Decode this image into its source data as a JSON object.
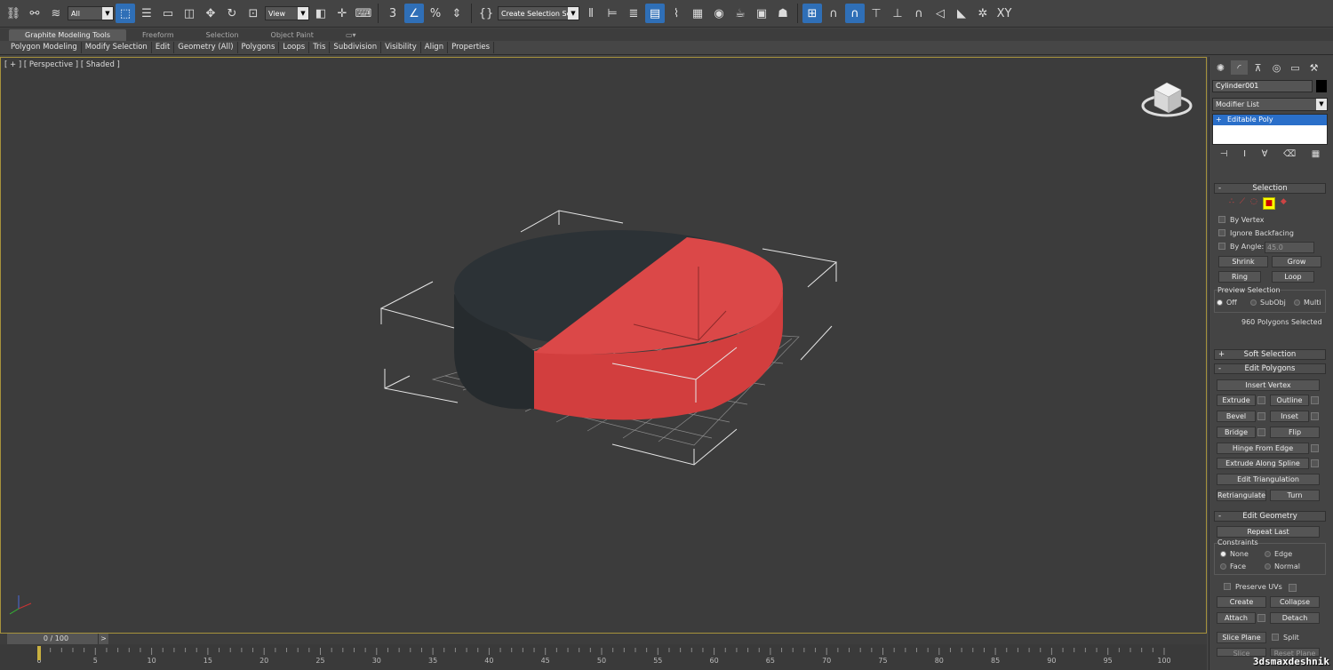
{
  "toolbar": {
    "selection_filter": "All",
    "ref_coord": "View",
    "named_selection": "Create Selection Se",
    "snap_3": "3",
    "snap_percent": "%",
    "xy_label": "XY"
  },
  "ribbon": {
    "tabs": [
      "Graphite Modeling Tools",
      "Freeform",
      "Selection",
      "Object Paint"
    ],
    "items": [
      "Polygon Modeling",
      "Modify Selection",
      "Edit",
      "Geometry (All)",
      "Polygons",
      "Loops",
      "Tris",
      "Subdivision",
      "Visibility",
      "Align",
      "Properties"
    ]
  },
  "viewport": {
    "label": "[ + ] [ Perspective ] [ Shaded ]",
    "red_color": "#d94444",
    "dark_color": "#2c3236"
  },
  "command_panel": {
    "object_name": "Cylinder001",
    "modifier_list": "Modifier List",
    "stack_item": "Editable Poly",
    "selection": {
      "title": "Selection",
      "by_vertex": "By Vertex",
      "ignore_backfacing": "Ignore Backfacing",
      "by_angle": "By Angle:",
      "angle_value": "45.0",
      "shrink": "Shrink",
      "grow": "Grow",
      "ring": "Ring",
      "loop": "Loop",
      "preview_selection": "Preview Selection",
      "off": "Off",
      "subobj": "SubObj",
      "multi": "Multi",
      "status": "960 Polygons Selected"
    },
    "soft_selection": "Soft Selection",
    "edit_polygons": {
      "title": "Edit Polygons",
      "insert_vertex": "Insert Vertex",
      "extrude": "Extrude",
      "outline": "Outline",
      "bevel": "Bevel",
      "inset": "Inset",
      "bridge": "Bridge",
      "flip": "Flip",
      "hinge_from_edge": "Hinge From Edge",
      "extrude_along_spline": "Extrude Along Spline",
      "edit_triangulation": "Edit Triangulation",
      "retriangulate": "Retriangulate",
      "turn": "Turn"
    },
    "edit_geometry": {
      "title": "Edit Geometry",
      "repeat_last": "Repeat Last",
      "constraints": "Constraints",
      "none": "None",
      "edge": "Edge",
      "face": "Face",
      "normal": "Normal",
      "preserve_uvs": "Preserve UVs",
      "create": "Create",
      "collapse": "Collapse",
      "attach": "Attach",
      "detach": "Detach",
      "slice_plane": "Slice Plane",
      "split": "Split",
      "slice": "Slice",
      "reset_plane": "Reset Plane"
    }
  },
  "timeline": {
    "frame": "0 / 100",
    "next": ">",
    "ticks": [
      "0",
      "5",
      "10",
      "15",
      "20",
      "25",
      "30",
      "35",
      "40",
      "45",
      "50",
      "55",
      "60",
      "65",
      "70",
      "75",
      "80",
      "85",
      "90",
      "95",
      "100"
    ]
  },
  "watermark": "3dsmaxdeshnik"
}
